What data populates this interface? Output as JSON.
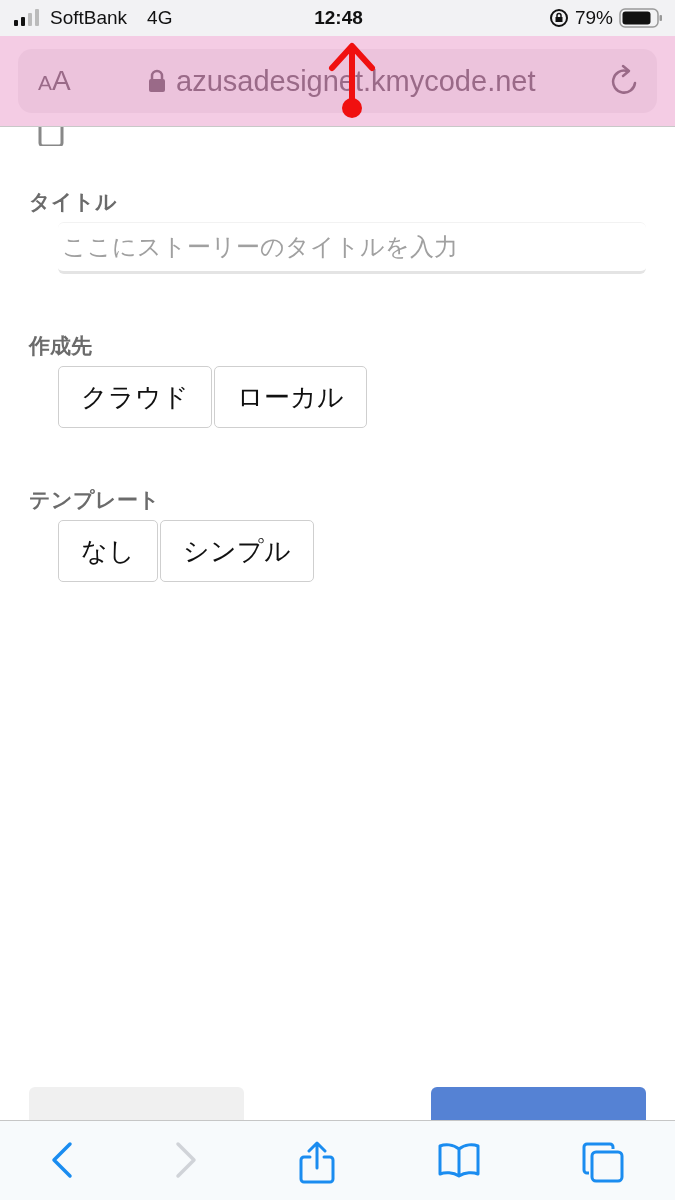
{
  "status_bar": {
    "carrier": "SoftBank",
    "network": "4G",
    "time": "12:48",
    "battery": "79%"
  },
  "address_bar": {
    "text_size": "AA",
    "url": "azusadesignet.kmycode.net"
  },
  "form": {
    "fields": [
      {
        "kind": "text",
        "label": "タイトル",
        "placeholder": "ここにストーリーのタイトルを入力"
      },
      {
        "kind": "choice",
        "label": "作成先",
        "options": [
          {
            "label": "クラウド",
            "selected": false
          },
          {
            "label": "ローカル",
            "selected": false
          }
        ]
      },
      {
        "kind": "choice",
        "label": "テンプレート",
        "options": [
          {
            "label": "なし",
            "selected": false
          },
          {
            "label": "シンプル",
            "selected": false
          }
        ]
      }
    ],
    "actions": [
      {
        "kind": "secondary"
      },
      {
        "kind": "primary"
      }
    ]
  },
  "toolbar": {
    "buttons": [
      {
        "kind": "back",
        "disabled": false
      },
      {
        "kind": "forward",
        "disabled": true
      },
      {
        "kind": "share",
        "disabled": false
      },
      {
        "kind": "bookmarks",
        "disabled": false
      },
      {
        "kind": "tabs",
        "disabled": false
      }
    ]
  }
}
